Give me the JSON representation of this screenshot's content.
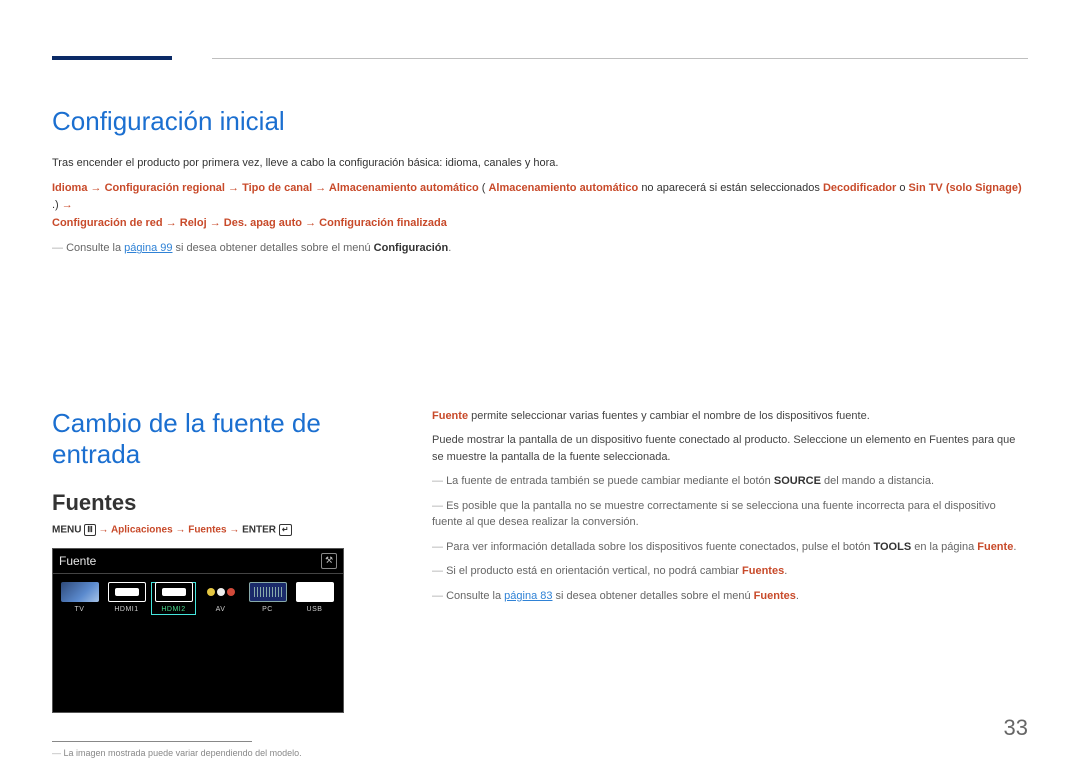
{
  "header": {},
  "section1": {
    "title": "Configuración inicial",
    "intro": "Tras encender el producto por primera vez, lleve a cabo la configuración básica: idioma, canales y hora.",
    "path": {
      "p1": "Idioma",
      "p2": "Configuración regional",
      "p3": "Tipo de canal",
      "p4": "Almacenamiento automático",
      "p4_note_open": " (",
      "p4_note_bold": "Almacenamiento automático",
      "p4_note_mid": " no aparecerá si están seleccionados ",
      "p4_note_b2": "Decodificador",
      "p4_note_or": " o ",
      "p4_note_b3": "Sin TV (solo Signage)",
      "p4_note_close": ".)",
      "p5": "Configuración de red",
      "p6": "Reloj",
      "p7": "Des. apag auto",
      "p8": "Configuración finalizada"
    },
    "note": {
      "pre": "Consulte la ",
      "link": "página 99",
      "mid": " si desea obtener detalles sobre el menú ",
      "bold": "Configuración",
      "post": "."
    }
  },
  "section2": {
    "title": "Cambio de la fuente de entrada",
    "subtitle": "Fuentes",
    "menupath": {
      "pre": "MENU ",
      "a1": "Aplicaciones",
      "a2": "Fuentes",
      "a3": "ENTER"
    },
    "panel": {
      "header": "Fuente",
      "items": [
        {
          "label": "TV",
          "icon": "tv",
          "selected": false
        },
        {
          "label": "HDMI1",
          "icon": "hdmi",
          "selected": false
        },
        {
          "label": "HDMI2",
          "icon": "hdmi",
          "selected": true
        },
        {
          "label": "AV",
          "icon": "av",
          "selected": false
        },
        {
          "label": "PC",
          "icon": "pc",
          "selected": false
        },
        {
          "label": "USB",
          "icon": "usb",
          "selected": false
        }
      ]
    },
    "footnote": "La imagen mostrada puede variar dependiendo del modelo.",
    "right": {
      "p1_b": "Fuente",
      "p1": " permite seleccionar varias fuentes y cambiar el nombre de los dispositivos fuente.",
      "p2": "Puede mostrar la pantalla de un dispositivo fuente conectado al producto. Seleccione un elemento en Fuentes para que se muestre la pantalla de la fuente seleccionada.",
      "d1_pre": "La fuente de entrada también se puede cambiar mediante el botón ",
      "d1_b": "SOURCE",
      "d1_post": " del mando a distancia.",
      "d2": "Es posible que la pantalla no se muestre correctamente si se selecciona una fuente incorrecta para el dispositivo fuente al que desea realizar la conversión.",
      "d3_pre": "Para ver información detallada sobre los dispositivos fuente conectados, pulse el botón ",
      "d3_b": "TOOLS",
      "d3_mid": " en la página ",
      "d3_b2": "Fuente",
      "d3_post": ".",
      "d4_pre": "Si el producto está en orientación vertical, no podrá cambiar ",
      "d4_b": "Fuentes",
      "d4_post": ".",
      "d5_pre": "Consulte la ",
      "d5_link": "página 83",
      "d5_mid": " si desea obtener detalles sobre el menú ",
      "d5_b": "Fuentes",
      "d5_post": "."
    }
  },
  "pagenum": "33"
}
